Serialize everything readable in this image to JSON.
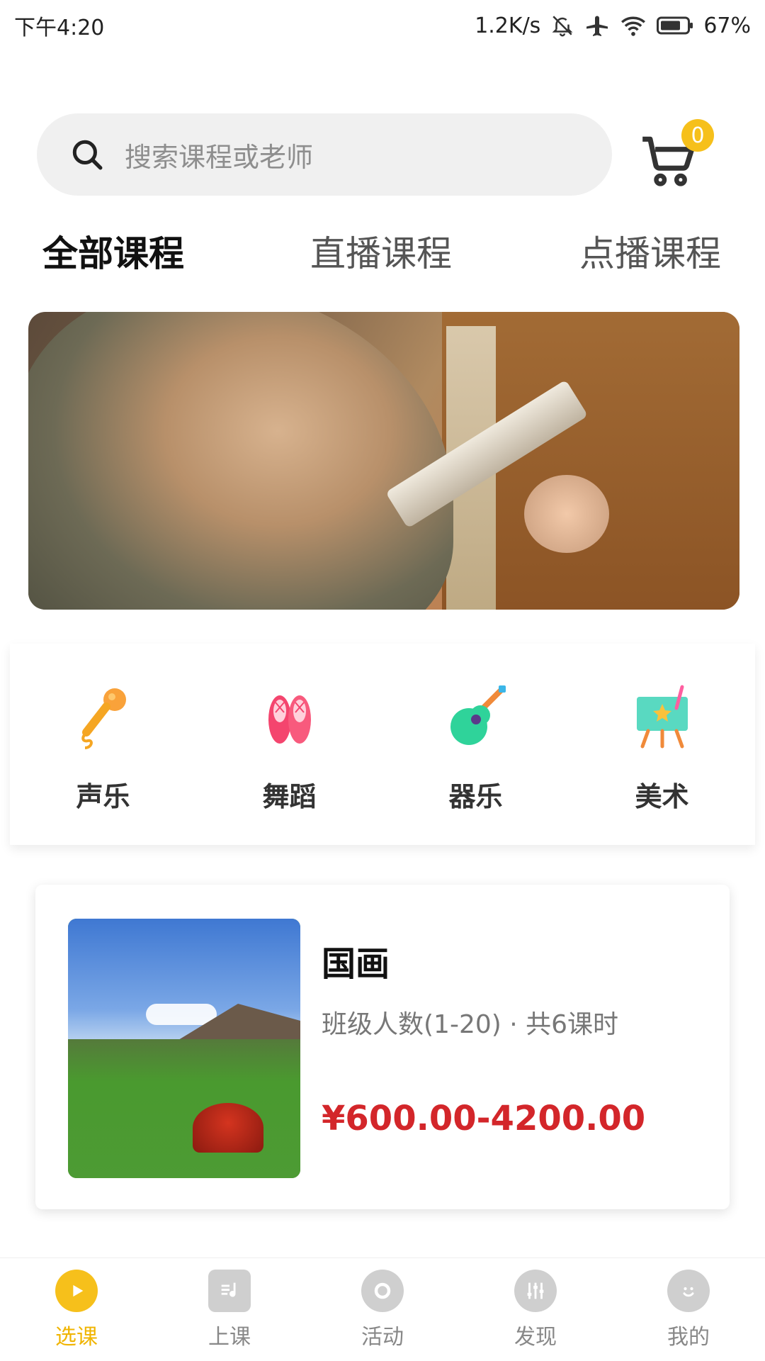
{
  "status_bar": {
    "time": "下午4:20",
    "network_speed": "1.2K/s",
    "battery": "67%",
    "icons": [
      "mute-icon",
      "airplane-icon",
      "wifi-icon",
      "battery-icon"
    ]
  },
  "search": {
    "placeholder": "搜索课程或老师"
  },
  "cart": {
    "count": "0"
  },
  "tabs": [
    {
      "label": "全部课程",
      "active": true
    },
    {
      "label": "直播课程",
      "active": false
    },
    {
      "label": "点播课程",
      "active": false
    }
  ],
  "categories": [
    {
      "label": "声乐",
      "icon": "microphone-icon"
    },
    {
      "label": "舞蹈",
      "icon": "ballet-shoes-icon"
    },
    {
      "label": "器乐",
      "icon": "guitar-icon"
    },
    {
      "label": "美术",
      "icon": "easel-icon"
    }
  ],
  "course": {
    "title": "国画",
    "meta": "班级人数(1-20) · 共6课时",
    "price": "¥600.00-4200.00"
  },
  "bottom_nav": [
    {
      "label": "选课",
      "icon": "play-icon",
      "active": true
    },
    {
      "label": "上课",
      "icon": "music-note-icon",
      "active": false
    },
    {
      "label": "活动",
      "icon": "record-icon",
      "active": false
    },
    {
      "label": "发现",
      "icon": "sliders-icon",
      "active": false
    },
    {
      "label": "我的",
      "icon": "smile-icon",
      "active": false
    }
  ],
  "colors": {
    "accent": "#f6c01b",
    "price": "#d3262a",
    "tab_highlight": "#ffd86b"
  }
}
